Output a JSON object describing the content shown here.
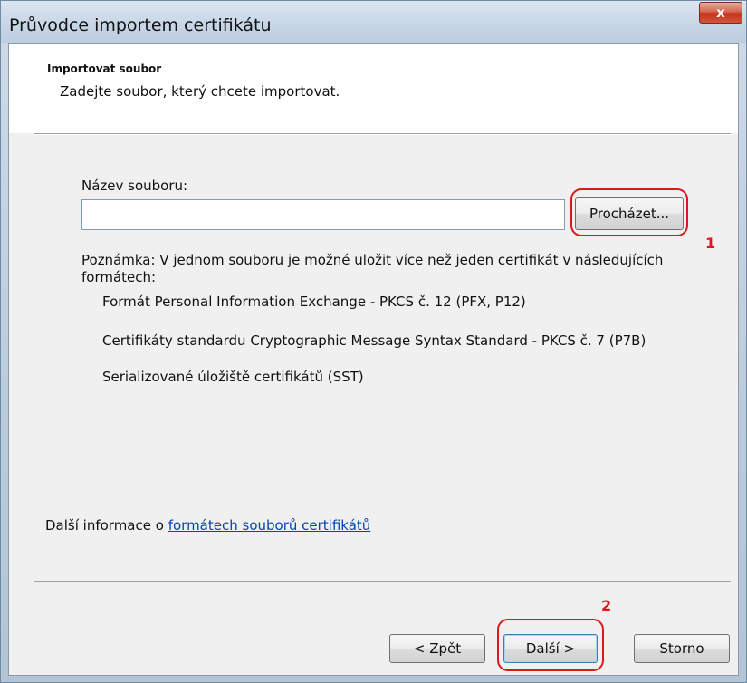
{
  "window": {
    "title": "Průvodce importem certifikátu",
    "close_symbol": "x"
  },
  "header": {
    "title": "Importovat soubor",
    "subtitle": "Zadejte soubor, který chcete importovat."
  },
  "file": {
    "label": "Název souboru:",
    "value": "",
    "browse_label": "Procházet..."
  },
  "note": {
    "line1": "Poznámka: V jednom souboru je možné uložit více než jeden certifikát v následujících",
    "line2": "formátech:",
    "formats": [
      "Formát Personal Information Exchange - PKCS č. 12 (PFX, P12)",
      "Certifikáty standardu Cryptographic Message Syntax Standard - PKCS č. 7 (P7B)",
      "Serializované úložiště certifikátů (SST)"
    ]
  },
  "more_info": {
    "prefix": "Další informace o ",
    "link": "formátech souborů certifikátů"
  },
  "footer": {
    "back_label": "< Zpět",
    "next_label": "Další >",
    "cancel_label": "Storno"
  },
  "annotations": {
    "marker1": "1",
    "marker2": "2",
    "color": "#d81a1a"
  }
}
